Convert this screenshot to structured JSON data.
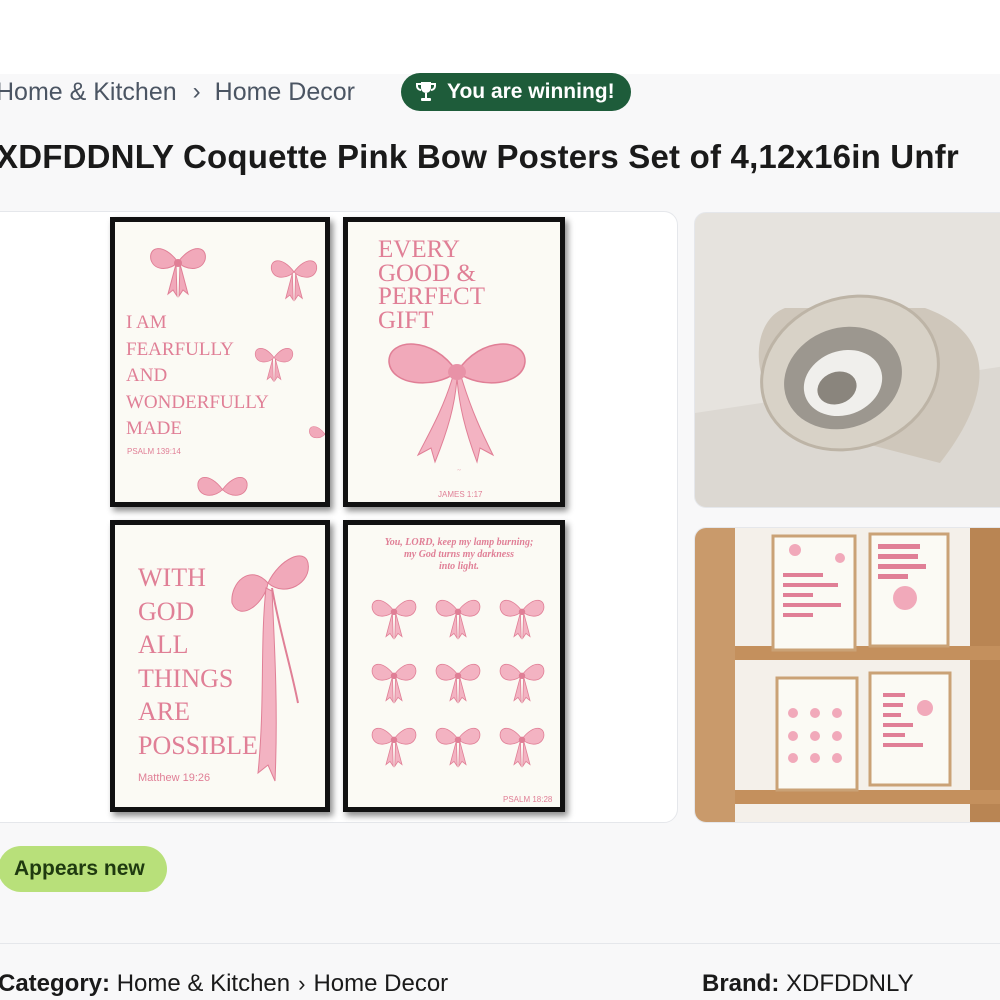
{
  "breadcrumb": {
    "items": [
      "Home & Kitchen",
      "Home Decor"
    ],
    "separator": "›"
  },
  "badge": {
    "label": "You are winning!",
    "icon": "trophy-icon",
    "color": "#1e5c3a"
  },
  "product": {
    "title": "XDFDDNLY Coquette Pink Bow Posters Set of 4,12x16in Unfr",
    "condition": "Appears new"
  },
  "posters": {
    "p1": {
      "text": "I AM\nFEARFULLY\nAND\nWONDERFULLY\nMADE",
      "ref": "PSALM 139:14"
    },
    "p2": {
      "text": "EVERY\nGOOD &\nPERFECT\nGIFT",
      "ref": "JAMES 1:17"
    },
    "p3": {
      "text": "WITH\nGOD\nALL\nTHINGS\nARE\nPOSSIBLE",
      "ref": "Matthew 19:26"
    },
    "p4": {
      "text": "You, LORD, keep my lamp burning;\nmy God turns my darkness\ninto light.",
      "ref": "PSALM 18:28"
    }
  },
  "details": {
    "category_label": "Category:",
    "category_path": [
      "Home & Kitchen",
      "Home Decor"
    ],
    "brand_label": "Brand:",
    "brand_value": "XDFDDNLY"
  },
  "colors": {
    "accent_pink": "#e07f96",
    "condition_green": "#b8e07a"
  }
}
